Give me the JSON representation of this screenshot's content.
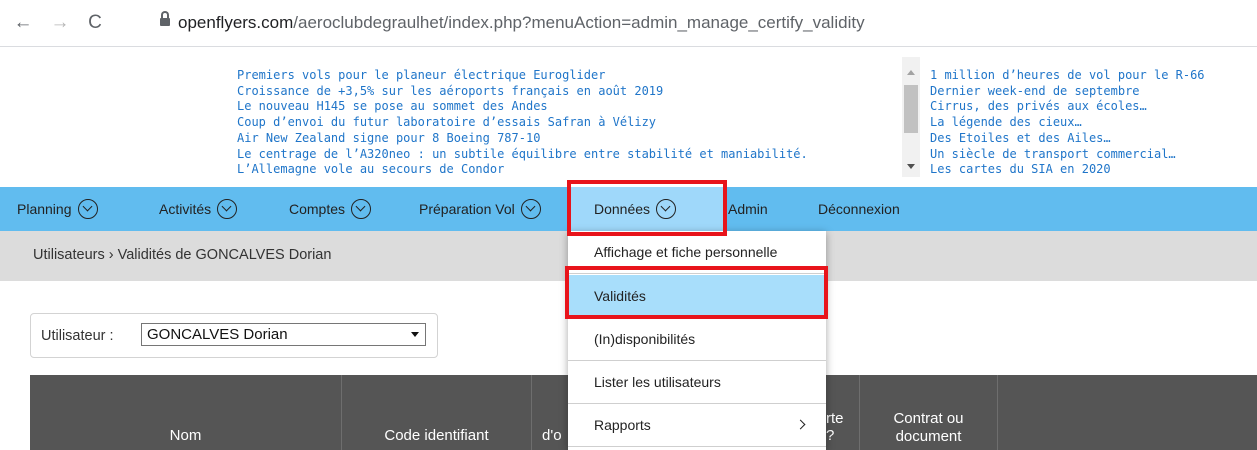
{
  "browser": {
    "back_icon": "back-arrow-icon",
    "forward_icon": "forward-arrow-icon",
    "reload_icon": "reload-icon",
    "lock_icon": "lock-icon",
    "url_domain": "openflyers.com",
    "url_path": "/aeroclubdegraulhet/index.php?menuAction=admin_manage_certify_validity"
  },
  "news_left": [
    "Premiers vols pour le planeur électrique Euroglider",
    "Croissance de +3,5% sur les aéroports français en août 2019",
    "Le nouveau H145 se pose au sommet des Andes",
    "Coup d’envoi du futur laboratoire d’essais Safran à Vélizy",
    "Air New Zealand signe pour 8 Boeing 787-10",
    "Le centrage de l’A320neo : un subtile équilibre entre stabilité et maniabilité.",
    "L’Allemagne vole au secours de Condor"
  ],
  "news_right": [
    "1 million d’heures de vol pour le R-66",
    "Dernier week-end de septembre",
    "Cirrus, des privés aux écoles…",
    "La légende des cieux…",
    "Des Etoiles et des Ailes…",
    "Un siècle de transport commercial…",
    "Les cartes du SIA en 2020"
  ],
  "nav": {
    "planning": "Planning",
    "activites": "Activités",
    "comptes": "Comptes",
    "preparation": "Préparation Vol",
    "donnees": "Données",
    "admin": "Admin",
    "deconnexion": "Déconnexion"
  },
  "breadcrumb": "Utilisateurs › Validités de GONCALVES Dorian",
  "selector": {
    "label": "Utilisateur :",
    "value": "GONCALVES Dorian"
  },
  "table_headers": {
    "nom": "Nom",
    "code": "Code identifiant",
    "col3_partial": "d'o",
    "col4_partial_top": "rte",
    "col4_partial_bottom": "?",
    "contrat_line1": "Contrat ou",
    "contrat_line2": "document"
  },
  "dropdown": {
    "items": [
      "Affichage et fiche personnelle",
      "Validités",
      "(In)disponibilités",
      "Lister les utilisateurs",
      "Rapports"
    ]
  },
  "colors": {
    "nav_bg": "#61bcef",
    "highlight_red": "#e8141b",
    "link_blue": "#1f75c9",
    "table_head": "#555555"
  }
}
